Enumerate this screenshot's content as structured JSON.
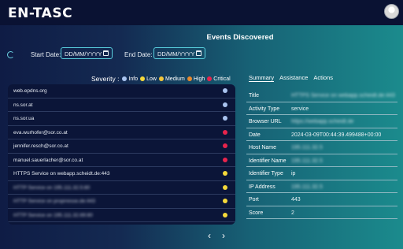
{
  "app": {
    "logo": "EN-TASC"
  },
  "page": {
    "title": "Events Discovered"
  },
  "filters": {
    "start_label": "Start Date:",
    "start_placeholder": "DD/MM/YYYY",
    "end_label": "End Date:",
    "end_placeholder": "DD/MM/YYYY"
  },
  "severity_legend": {
    "title": "Severity :",
    "items": [
      {
        "label": "Info",
        "color": "#a9c4f0"
      },
      {
        "label": "Low",
        "color": "#f5d93a"
      },
      {
        "label": "Medium",
        "color": "#f3c53a"
      },
      {
        "label": "High",
        "color": "#e98a2e"
      },
      {
        "label": "Critical",
        "color": "#e8244c"
      }
    ]
  },
  "events": [
    {
      "label": "web.epdns.org",
      "color": "#a9c4f0"
    },
    {
      "label": "ns.sor.at",
      "color": "#a9c4f0"
    },
    {
      "label": "ns.sor.ua",
      "color": "#a9c4f0"
    },
    {
      "label": "eva.wurhofer@sor.co.at",
      "color": "#e8244c"
    },
    {
      "label": "jennifer.resch@sor.co.at",
      "color": "#e8244c"
    },
    {
      "label": "manuel.sauerlacher@sor.co.at",
      "color": "#e8244c"
    },
    {
      "label": "HTTPS Service on webapp.scheidt.de:443",
      "color": "#f5d93a"
    },
    {
      "label": "HTTP Service on 195.111.32.5:80",
      "color": "#f5d93a"
    },
    {
      "label": "HTTP Service on proprresse.de:443",
      "color": "#f5d93a"
    },
    {
      "label": "HTTP Service on 195.111.32.69:80",
      "color": "#f5d93a"
    }
  ],
  "pager": {
    "prev": "‹",
    "next": "›"
  },
  "detail_tabs": [
    "Summary",
    "Assistance",
    "Actions"
  ],
  "details": [
    {
      "key": "Title",
      "value": "HTTPS Service on webapp.scheidt.de:443",
      "blurred": true
    },
    {
      "key": "Activity Type",
      "value": "service",
      "blurred": false
    },
    {
      "key": "Browser URL",
      "value": "https://webapp.scheidt.de",
      "blurred": true
    },
    {
      "key": "Date",
      "value": "2024-03-09T00:44:39.499488+00:00",
      "blurred": false
    },
    {
      "key": "Host Name",
      "value": "195.111.32.5",
      "blurred": true
    },
    {
      "key": "Identifier Name",
      "value": "195.111.32.5",
      "blurred": true
    },
    {
      "key": "Identifier Type",
      "value": "ip",
      "blurred": false
    },
    {
      "key": "IP Address",
      "value": "195.111.32.5",
      "blurred": true
    },
    {
      "key": "Port",
      "value": "443",
      "blurred": false
    },
    {
      "key": "Score",
      "value": "2",
      "blurred": false
    }
  ]
}
